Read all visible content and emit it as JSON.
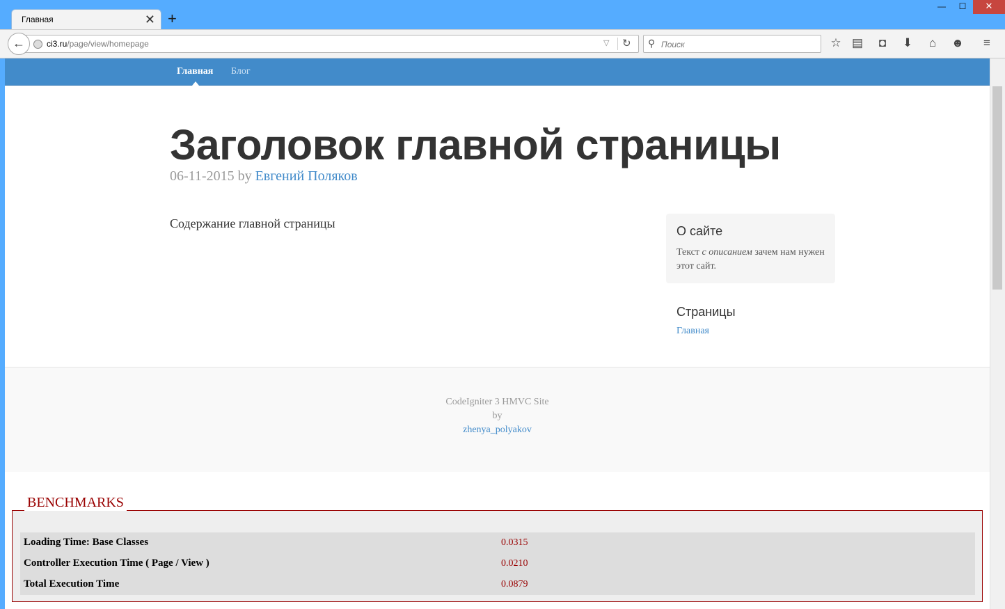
{
  "browser": {
    "tab_title": "Главная",
    "tab_close": "✕",
    "new_tab": "+",
    "url_host": "ci3.ru",
    "url_path": "/page/view/homepage",
    "search_placeholder": "Поиск",
    "window_controls": {
      "minimize": "—",
      "maximize": "☐",
      "close": "✕"
    },
    "icons": [
      "back-arrow-icon",
      "globe-icon",
      "dropdown-icon",
      "reload-icon",
      "search-icon",
      "bookmark-star-icon",
      "reading-list-icon",
      "pocket-icon",
      "download-icon",
      "home-icon",
      "chat-icon",
      "menu-icon"
    ]
  },
  "site": {
    "nav": [
      {
        "label": "Главная",
        "active": true
      },
      {
        "label": "Блог",
        "active": false
      }
    ],
    "title": "Заголовок главной страницы",
    "date": "06-11-2015",
    "by": "by",
    "author": "Евгений Поляков",
    "content": "Содержание главной страницы",
    "sidebar": {
      "about_title": "О сайте",
      "about_text_start": "Текст ",
      "about_text_em": "с описанием",
      "about_text_end": " зачем нам нужен этот сайт.",
      "pages_title": "Страницы",
      "pages_link": "Главная"
    },
    "footer": {
      "line1": "CodeIgniter 3 HMVC Site",
      "line2": "by",
      "link": "zhenya_polyakov"
    }
  },
  "benchmarks": {
    "legend": "BENCHMARKS",
    "rows": [
      {
        "key": "Loading Time: Base Classes",
        "value": "0.0315"
      },
      {
        "key": "Controller Execution Time ( Page / View )",
        "value": "0.0210"
      },
      {
        "key": "Total Execution Time",
        "value": "0.0879"
      }
    ]
  },
  "colors": {
    "chrome_blue": "#55acff",
    "nav_blue": "#428bca",
    "benchmark_red": "#990000"
  }
}
